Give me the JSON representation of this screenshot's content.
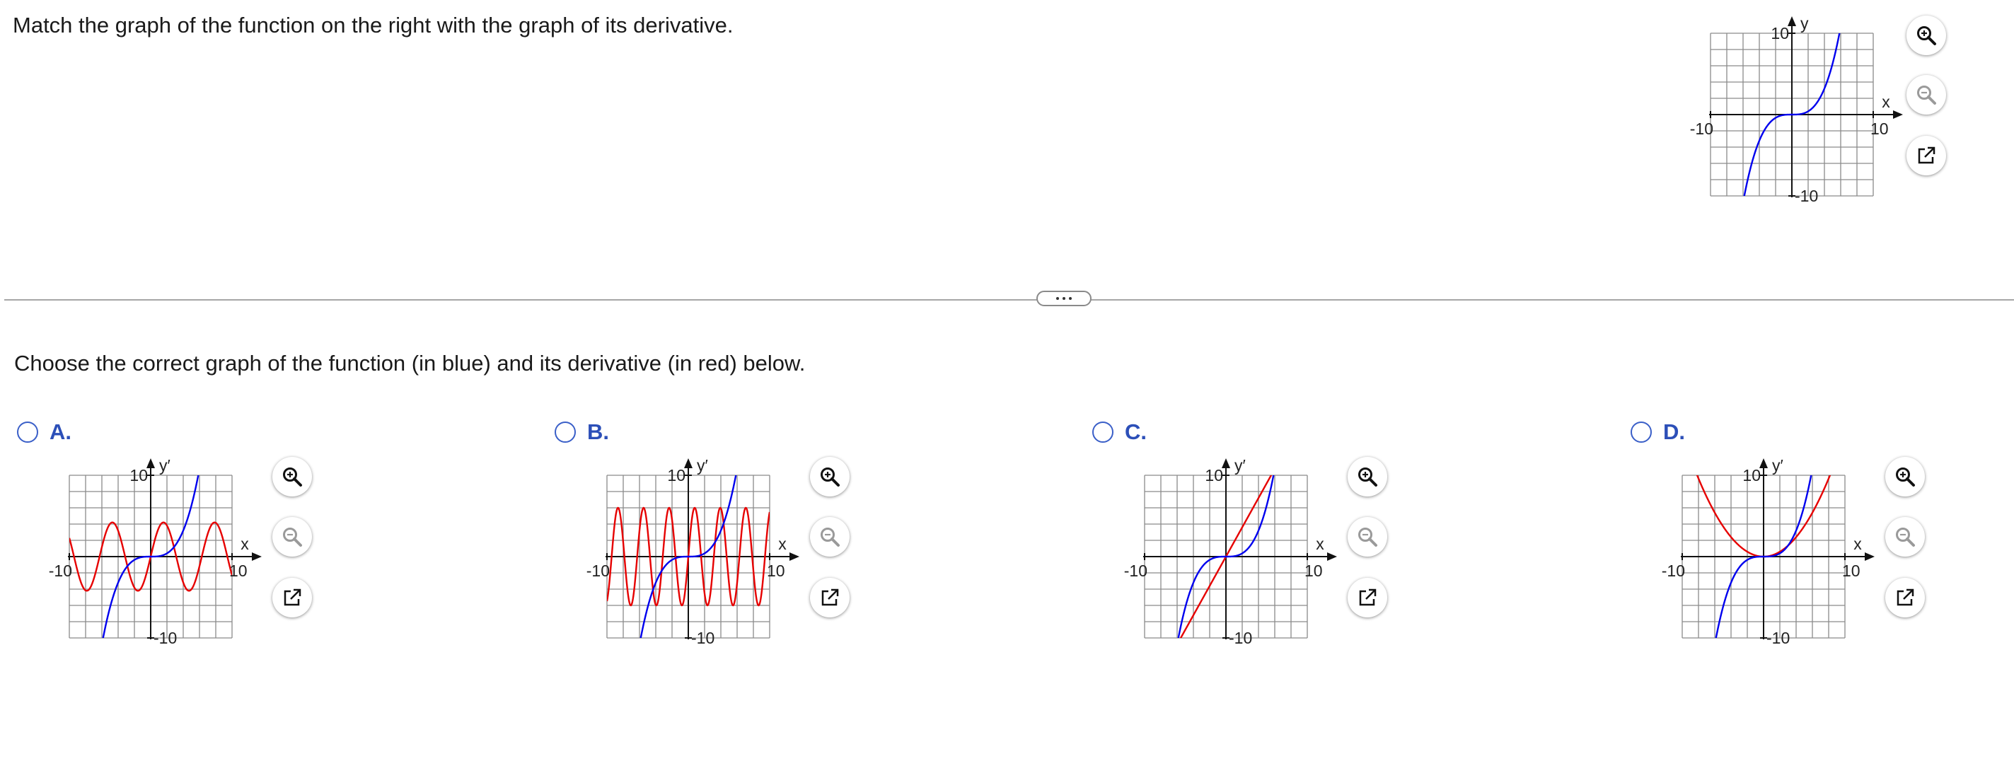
{
  "question": {
    "prompt": "Match the graph of the function on the right with the graph of its derivative.",
    "instruction": "Choose the correct graph of the function (in blue) and its derivative (in red) below."
  },
  "colors": {
    "function_curve": "#0000ee",
    "derivative_curve": "#e60000",
    "grid": "#8a8a8a",
    "radio_accent": "#3a5fc8"
  },
  "icons": {
    "zoom_in": "zoom-in-icon",
    "zoom_out": "zoom-out-icon",
    "open_new_window": "external-link-icon",
    "divider_handle": "ellipsis-icon"
  },
  "given_graph": {
    "y_label": "y",
    "x_label": "x",
    "tick_labels": {
      "x_min": "-10",
      "x_max": "10",
      "y_max": "10",
      "y_min": "-10"
    },
    "xlim": [
      -10,
      10
    ],
    "ylim": [
      -10,
      10
    ],
    "grid": true,
    "function": "0.05*x^3"
  },
  "options": [
    {
      "letter": "A.",
      "y_label": "y′",
      "x_label": "x",
      "tick_labels": {
        "x_min": "-10",
        "x_max": "10",
        "y_max": "10",
        "y_min": "-10"
      },
      "blue": "0.05*x^3",
      "red": "5*sin(x)",
      "red_desc": "sine wave, amplitude about 4"
    },
    {
      "letter": "B.",
      "y_label": "y′",
      "x_label": "x",
      "tick_labels": {
        "x_min": "-10",
        "x_max": "10",
        "y_max": "10",
        "y_min": "-10"
      },
      "blue": "0.05*x^3",
      "red": "6*sin(2x)",
      "red_desc": "sine wave, amplitude about 6"
    },
    {
      "letter": "C.",
      "y_label": "y′",
      "x_label": "x",
      "tick_labels": {
        "x_min": "-10",
        "x_max": "10",
        "y_max": "10",
        "y_min": "-10"
      },
      "blue": "0.05*x^3",
      "red": "1.8*x",
      "red_desc": "straight line through origin"
    },
    {
      "letter": "D.",
      "y_label": "y′",
      "x_label": "x",
      "tick_labels": {
        "x_min": "-10",
        "x_max": "10",
        "y_max": "10",
        "y_min": "-10"
      },
      "blue": "0.05*x^3",
      "red": "0.15*x^2",
      "red_desc": "parabola, vertex at origin"
    }
  ]
}
